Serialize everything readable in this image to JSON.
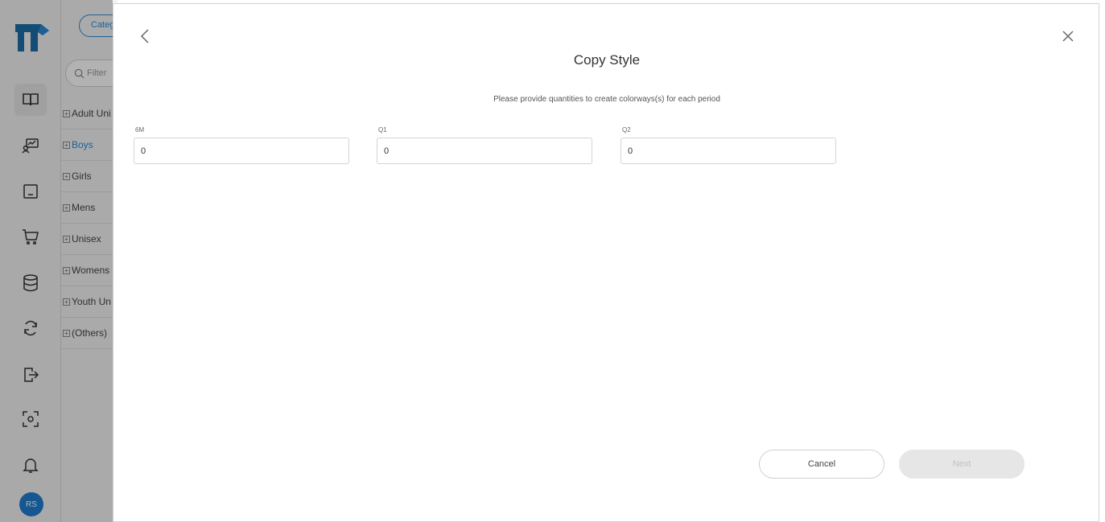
{
  "colors": {
    "accent": "#2a8ad6",
    "avatar_bg": "#1f7fd0",
    "overlay": "rgba(0,0,0,0.30)"
  },
  "rail": {
    "logo": "tailorsoft-logo",
    "icons": [
      "book-icon",
      "person-chart-icon",
      "tray-icon",
      "cart-icon",
      "database-icon",
      "sync-icon",
      "export-icon",
      "scan-icon",
      "bell-icon"
    ],
    "avatar_initials": "RS"
  },
  "category_panel": {
    "category_button": "Categ",
    "filter_placeholder": "Filter",
    "items": [
      {
        "label": "Adult Uni"
      },
      {
        "label": "Boys"
      },
      {
        "label": "Girls"
      },
      {
        "label": "Mens"
      },
      {
        "label": "Unisex"
      },
      {
        "label": "Womens"
      },
      {
        "label": "Youth Un"
      },
      {
        "label": "(Others)"
      }
    ]
  },
  "modal": {
    "title": "Copy Style",
    "subtitle": "Please provide quantities to create colorways(s) for each period",
    "fields": [
      {
        "label": "6M",
        "value": "0"
      },
      {
        "label": "Q1",
        "value": "0"
      },
      {
        "label": "Q2",
        "value": "0"
      }
    ],
    "cancel_label": "Cancel",
    "next_label": "Next"
  }
}
